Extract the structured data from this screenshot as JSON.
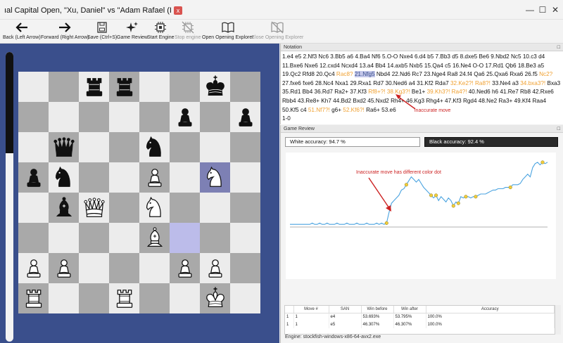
{
  "window": {
    "tab_title": "ıal Capital Open, \"Xu, Daniel\" vs \"Adam Rafael (I",
    "tab_close": "x"
  },
  "toolbar": {
    "back": "Back (Left Arrow)",
    "forward": "Forward (Right Arrow)",
    "save": "Save (Ctrl+S)",
    "game_review": "Game Review",
    "start_engine": "Start Engine",
    "stop_engine": "Stop engine",
    "open_opening_explorer": "Open Opening Explorer",
    "close_opening_explorer": "Close Opening Explorer"
  },
  "eval_bar": {
    "black_fraction": 0.35
  },
  "board": {
    "ranks": [
      [
        "",
        "",
        "bR",
        "bR",
        "",
        "",
        "bK",
        ""
      ],
      [
        "",
        "",
        "",
        "",
        "",
        "bP",
        "",
        "bP"
      ],
      [
        "",
        "bQ",
        "",
        "",
        "bN",
        "",
        "",
        ""
      ],
      [
        "bP",
        "bN",
        "",
        "",
        "wP",
        "",
        "wN",
        ""
      ],
      [
        "",
        "bB",
        "wQ",
        "",
        "wN",
        "",
        "",
        ""
      ],
      [
        "",
        "",
        "",
        "",
        "wB",
        "",
        "",
        ""
      ],
      [
        "wP",
        "wP",
        "",
        "",
        "",
        "wP",
        "wP",
        ""
      ],
      [
        "wR",
        "",
        "",
        "wR",
        "",
        "",
        "wK",
        ""
      ]
    ],
    "highlight_dark": "g5",
    "highlight_light": "f3"
  },
  "notation": {
    "header": "Notation",
    "text_plain_1": "1.e4 e5 2.Nf3 Nc6 3.Bb5 a6 4.Ba4 Nf6 5.O-O Nxe4 6.d4 b5 7.Bb3 d5 8.dxe5 Be6 9.Nbd2 Nc5 10.c3 d4 11.Bxe6 Nxe6 12.cxd4 Ncxd4 13.a4 Bb4 14.axb5 Nxb5 15.Qa4 c5 16.Ne4 O-O 17.Rd1 Qb6 18.Be3 a5 19.Qc2 Rfd8 20.Qc4",
    "m20b": "Rac8?",
    "m21": "21.Nfg5",
    "text_plain_2": "Nbd4 22.Nd6 Rc7 23.Nge4 Ra8 24.f4 Qa6 25.Qxa6 Rxa6 26.f5",
    "m26b": "Nc2?",
    "text_plain_3": "27.fxe6 fxe6 28.Nc4 Nxa1 29.Rxa1 Rd7 30.Ned6 a4 31.Kf2 Rda7",
    "m32": "32.Ke2?! Ra8?!",
    "text_plain_4": "33.Ne4 a3",
    "m34": "34.bxa3?!",
    "text_plain_5": "Bxa3 35.Rd1 Bb4 36.Rd7 Ra2+ 37.Kf3",
    "m37b": "Rf8+?! 38.Kg3?!",
    "text_plain_6": "Be1+",
    "m39": "39.Kh3?! Ra4?!",
    "text_plain_7": "40.Ned6 h6 41.Re7 Rb8 42.Rxe6 Rbb4 43.Re8+ Kh7 44.Bd2 Bxd2 45.Nxd2 Rh4+ 46.Kg3 Rhg4+ 47.Kf3 Rgd4 48.Ne2 Ra3+ 49.Kf4 Raa4 50.Kf5 c4",
    "m51": "51.Nf7?!",
    "text_plain_8": "g6+",
    "m52": "52.Kf6?!",
    "text_plain_9": "Ra6+ 53.e6",
    "result": "1-0",
    "annotation": "inaccurate move"
  },
  "review": {
    "header": "Game Review",
    "white_accuracy": "White accuracy: 94.7 %",
    "black_accuracy": "Black accuracy: 92.4 %",
    "annotation": "Inaccurate move has different color dot",
    "table_headers": [
      "",
      "Move #",
      "SAN",
      "Win before",
      "Win after",
      "Accuracy"
    ],
    "table_rows": [
      [
        "1",
        "1",
        "e4",
        "53.693%",
        "53.795%",
        "100.0%"
      ],
      [
        "1",
        "1",
        "e5",
        "46.307%",
        "46.307%",
        "100.0%"
      ]
    ],
    "engine": "Engine: stockfish-windows-x86-64-avx2.exe"
  },
  "chart_data": {
    "type": "line",
    "title": "",
    "xlabel": "",
    "ylabel": "",
    "x_count": 105,
    "y": [
      0.52,
      0.52,
      0.52,
      0.52,
      0.52,
      0.52,
      0.52,
      0.52,
      0.52,
      0.53,
      0.52,
      0.52,
      0.53,
      0.52,
      0.52,
      0.53,
      0.52,
      0.52,
      0.52,
      0.53,
      0.52,
      0.52,
      0.52,
      0.53,
      0.52,
      0.52,
      0.52,
      0.53,
      0.52,
      0.52,
      0.52,
      0.53,
      0.52,
      0.52,
      0.52,
      0.53,
      0.52,
      0.53,
      0.52,
      0.53,
      0.61,
      0.68,
      0.7,
      0.72,
      0.74,
      0.78,
      0.79,
      0.82,
      0.85,
      0.88,
      0.86,
      0.84,
      0.86,
      0.83,
      0.8,
      0.78,
      0.76,
      0.74,
      0.72,
      0.74,
      0.7,
      0.73,
      0.71,
      0.69,
      0.72,
      0.7,
      0.66,
      0.69,
      0.68,
      0.73,
      0.72,
      0.73,
      0.73,
      0.72,
      0.73,
      0.73,
      0.74,
      0.75,
      0.75,
      0.75,
      0.76,
      0.77,
      0.78,
      0.78,
      0.79,
      0.79,
      0.79,
      0.8,
      0.8,
      0.8,
      0.82,
      0.82,
      0.82,
      0.83,
      0.86,
      0.88,
      0.9,
      0.88,
      0.95,
      0.98,
      0.99,
      0.97,
      0.99,
      0.98,
      0.99
    ],
    "inaccurate_indices": [
      39,
      47,
      57,
      59,
      66,
      68,
      71,
      75,
      89,
      102
    ]
  }
}
